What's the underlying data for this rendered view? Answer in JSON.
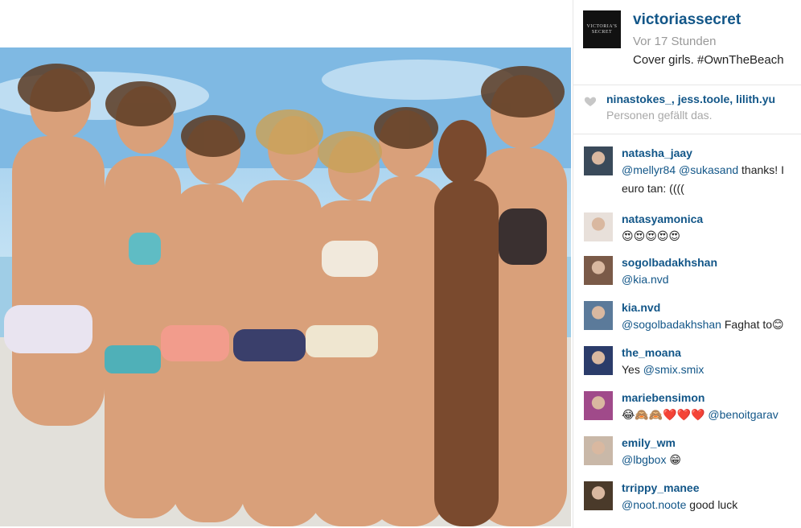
{
  "post": {
    "username": "victoriassecret",
    "logo_text": "VICTORIA'S SECRET",
    "time": "Vor 17 Stunden",
    "caption": "Cover girls. #OwnTheBeach"
  },
  "likes": {
    "names": "ninastokes_, jess.toole, lilith.yu",
    "suffix": "Personen gefällt das."
  },
  "comments": [
    {
      "user": "natasha_jaay",
      "mention": "@mellyr84 @sukasand",
      "text": " thanks! I",
      "line2": "euro tan: (((("
    },
    {
      "user": "natasyamonica",
      "text": "😍😍😍😍😍"
    },
    {
      "user": "sogolbadakhshan",
      "mention": "@kia.nvd",
      "text": ""
    },
    {
      "user": "kia.nvd",
      "mention": "@sogolbadakhshan",
      "text": " Faghat to😊"
    },
    {
      "user": "the_moana",
      "text": "Yes ",
      "mention": "@smix.smix"
    },
    {
      "user": "mariebensimon",
      "text": "😂🙈🙈❤️❤️❤️ ",
      "mention": "@benoitgarav"
    },
    {
      "user": "emily_wm",
      "mention": "@lbgbox",
      "text": " 😁"
    },
    {
      "user": "trrippy_manee",
      "mention": "@noot.noote",
      "text": " good luck"
    }
  ],
  "colors": {
    "link": "#125688",
    "muted": "#999999",
    "heart": "#c7c7c7"
  }
}
